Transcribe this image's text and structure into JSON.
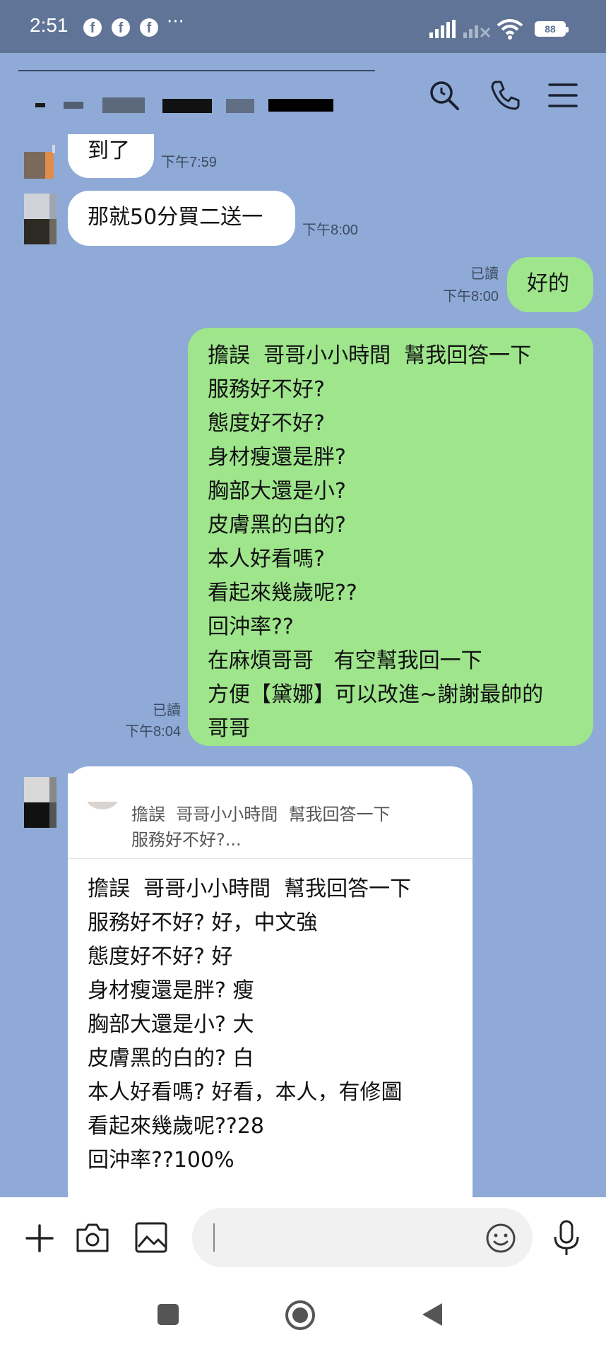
{
  "status": {
    "time": "2:51",
    "fb": "f",
    "more": "···",
    "battery": "88"
  },
  "messages": [
    {
      "dir": "in",
      "text": "到了",
      "time": "下午7:59"
    },
    {
      "dir": "in",
      "text": "那就50分買二送一",
      "time": "下午8:00"
    },
    {
      "dir": "out",
      "text": "好的",
      "read": "已讀",
      "time": "下午8:00"
    },
    {
      "dir": "out",
      "read": "已讀",
      "time": "下午8:04",
      "lines": [
        "擔誤  哥哥小小時間  幫我回答一下",
        "服務好不好?",
        "態度好不好?",
        "身材瘦還是胖?",
        "胸部大還是小?",
        "皮膚黑的白的?",
        "本人好看嗎?",
        "看起來幾歲呢??",
        "回沖率??",
        "在麻煩哥哥   有空幫我回一下",
        "方便【黛娜】可以改進~謝謝最帥的",
        "哥哥"
      ]
    },
    {
      "dir": "in",
      "quote": [
        "擔誤  哥哥小小時間  幫我回答一下",
        "服務好不好?..."
      ],
      "lines": [
        "擔誤  哥哥小小時間  幫我回答一下",
        "服務好不好? 好，中文強",
        "態度好不好? 好",
        "身材瘦還是胖? 瘦",
        "胸部大還是小? 大",
        "皮膚黑的白的? 白",
        "本人好看嗎? 好看，本人，有修圖",
        "看起來幾歲呢??28",
        "回沖率??100%"
      ]
    }
  ]
}
